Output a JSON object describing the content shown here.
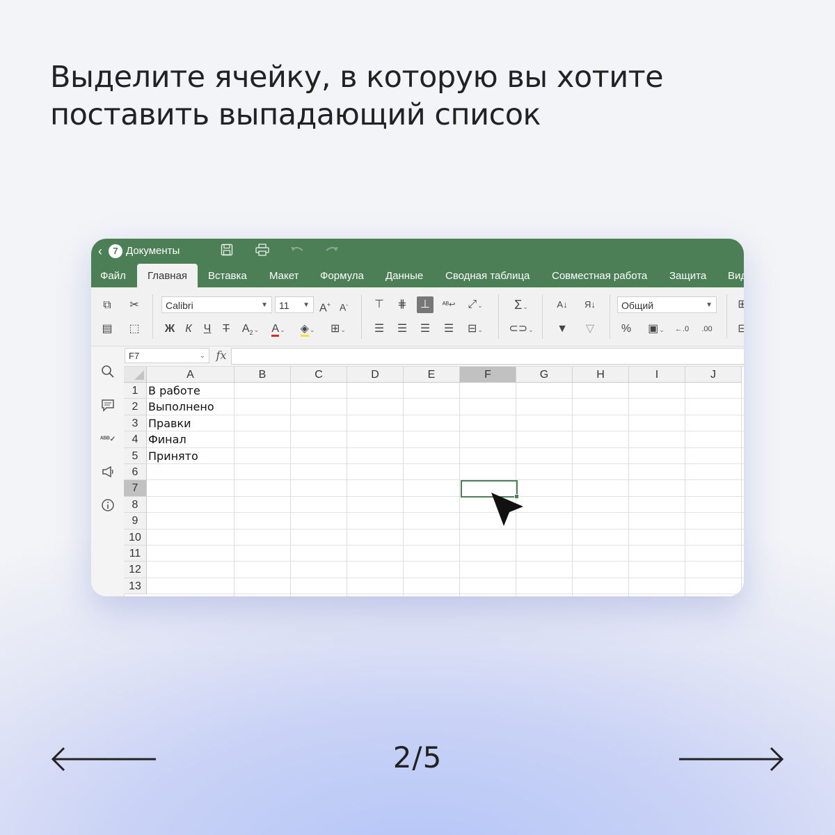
{
  "headline": {
    "line1": "Выделите ячейку, в которую вы хотите",
    "line2": "поставить выпадающий список"
  },
  "app": {
    "title": "Документы",
    "accent_color": "#4d7f56"
  },
  "tabs": [
    "Файл",
    "Главная",
    "Вставка",
    "Макет",
    "Формула",
    "Данные",
    "Сводная таблица",
    "Совместная работа",
    "Защита",
    "Вид"
  ],
  "active_tab": "Главная",
  "toolbar": {
    "font_name": "Calibri",
    "font_size": "11",
    "number_format": "Общий",
    "bold": "Ж",
    "italic": "К",
    "underline": "Ч",
    "strike": "Т",
    "percent": "%"
  },
  "formula_bar": {
    "name_box": "F7",
    "fx_label": "fx",
    "formula": ""
  },
  "sheet": {
    "columns": [
      "A",
      "B",
      "C",
      "D",
      "E",
      "F",
      "G",
      "H",
      "I",
      "J"
    ],
    "rows": [
      "1",
      "2",
      "3",
      "4",
      "5",
      "6",
      "7",
      "8",
      "9",
      "10",
      "11",
      "12",
      "13"
    ],
    "active_column": "F",
    "active_row": "7",
    "cells_A": [
      "В работе",
      "Выполнено",
      "Правки",
      "Финал",
      "Принято"
    ]
  },
  "pagination": {
    "counter": "2/5"
  }
}
